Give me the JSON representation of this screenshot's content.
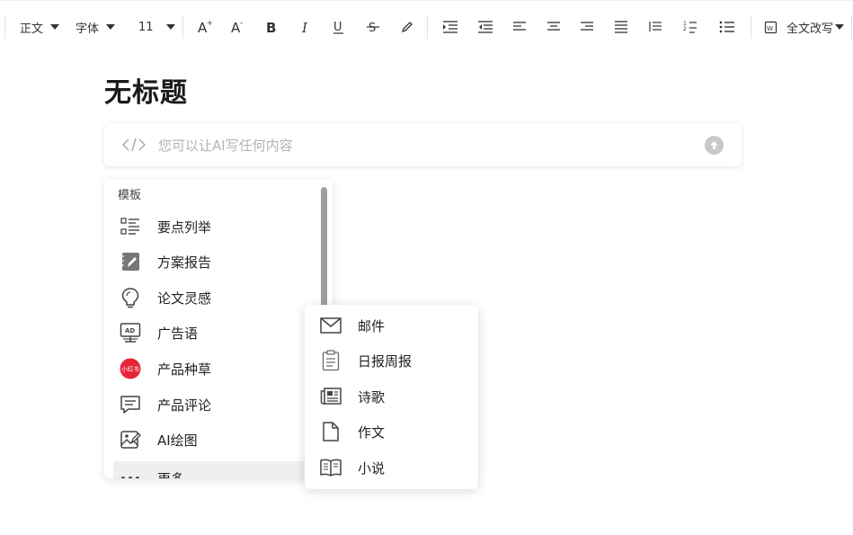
{
  "toolbar": {
    "paragraph_style": "正文",
    "font_family": "字体",
    "font_size": "11",
    "rewrite_label": "全文改写"
  },
  "document": {
    "title": "无标题"
  },
  "ai_prompt": {
    "placeholder": "您可以让AI写任何内容"
  },
  "template_menu": {
    "header": "模板",
    "items": [
      {
        "label": "要点列举",
        "icon": "bullet-list-icon"
      },
      {
        "label": "方案报告",
        "icon": "report-icon"
      },
      {
        "label": "论文灵感",
        "icon": "lightbulb-icon"
      },
      {
        "label": "广告语",
        "icon": "ad-board-icon"
      },
      {
        "label": "产品种草",
        "icon": "xiaohongshu-icon"
      },
      {
        "label": "产品评论",
        "icon": "comment-icon"
      },
      {
        "label": "AI绘图",
        "icon": "ai-image-icon"
      },
      {
        "label": "更多",
        "icon": "more-dots-icon"
      }
    ],
    "xiaohongshu_badge": "小红书",
    "badge_color": "#e8263a"
  },
  "more_submenu": {
    "items": [
      {
        "label": "邮件",
        "icon": "mail-icon"
      },
      {
        "label": "日报周报",
        "icon": "clipboard-icon"
      },
      {
        "label": "诗歌",
        "icon": "newspaper-icon"
      },
      {
        "label": "作文",
        "icon": "document-icon"
      },
      {
        "label": "小说",
        "icon": "book-icon"
      }
    ]
  }
}
